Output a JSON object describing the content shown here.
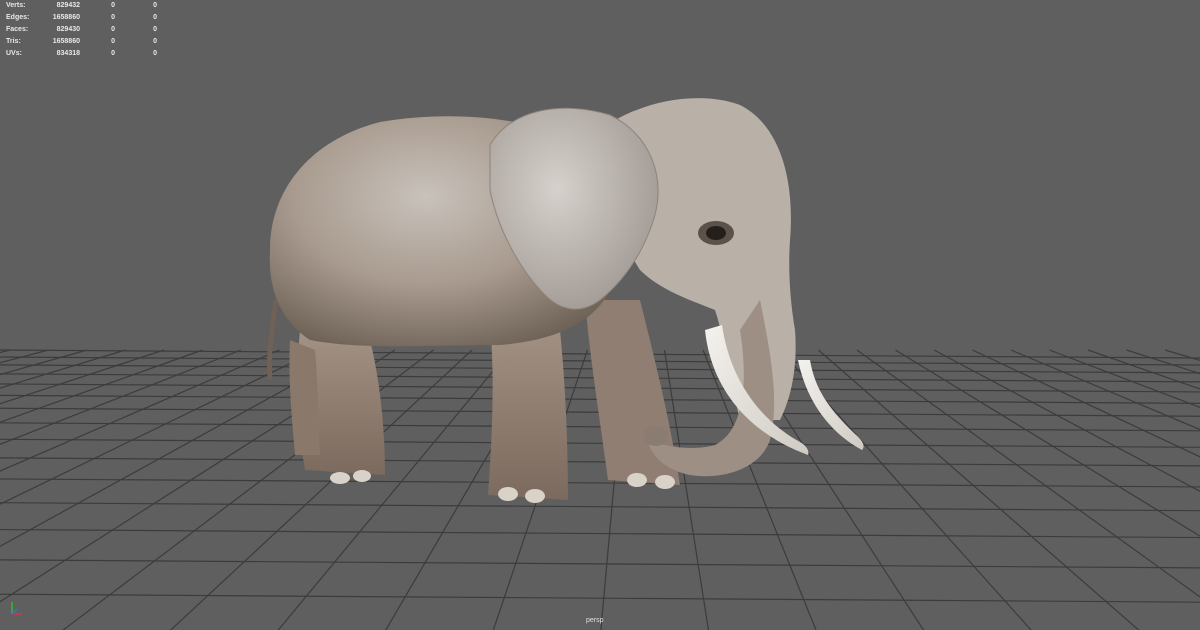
{
  "hud": {
    "rows": [
      {
        "label": "Verts:",
        "v1": "829432",
        "v2": "0",
        "v3": "0"
      },
      {
        "label": "Edges:",
        "v1": "1658860",
        "v2": "0",
        "v3": "0"
      },
      {
        "label": "Faces:",
        "v1": "829430",
        "v2": "0",
        "v3": "0"
      },
      {
        "label": "Tris:",
        "v1": "1658860",
        "v2": "0",
        "v3": "0"
      },
      {
        "label": "UVs:",
        "v1": "834318",
        "v2": "0",
        "v3": "0"
      }
    ]
  },
  "viewport": {
    "camera_label": "persp",
    "background_color": "#5f5f5f",
    "grid_color": "#3a3a3a"
  },
  "icons": {
    "axis": "view-axis-icon",
    "model": "elephant-model"
  }
}
